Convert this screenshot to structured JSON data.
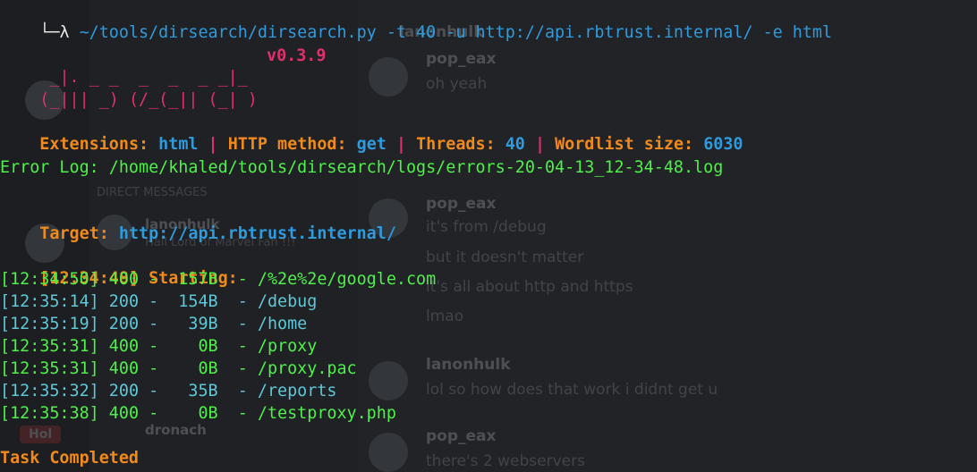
{
  "prompt": {
    "symbol": "└─λ",
    "command": " ~/tools/dirsearch/dirsearch.py -t 40 -u http://api.rbtrust.internal/ -e html"
  },
  "banner": {
    "art_line1": " _|. _ _  _  _  _ _|_",
    "art_line2": "(_||| _) (/_(_|| (_| )",
    "version": "v0.3.9"
  },
  "info": {
    "extensions_label": "Extensions: ",
    "extensions_value": "html",
    "sep": " | ",
    "method_label": "HTTP method: ",
    "method_value": "get",
    "threads_label": "Threads: ",
    "threads_value": "40",
    "wordlist_label": "Wordlist size: ",
    "wordlist_value": "6030"
  },
  "error_log": "Error Log: /home/khaled/tools/dirsearch/logs/errors-20-04-13_12-34-48.log",
  "target": {
    "label": "Target: ",
    "url": "http://api.rbtrust.internal/"
  },
  "start": {
    "time": "[12:34:48]",
    "label": " Starting: "
  },
  "results": [
    {
      "time": "[12:34:50]",
      "rest": " 400 -  157B  - /%2e%2e/google.com"
    },
    {
      "time": "[12:35:14]",
      "rest": " 200 -  154B  - /debug"
    },
    {
      "time": "[12:35:19]",
      "rest": " 200 -   39B  - /home"
    },
    {
      "time": "[12:35:31]",
      "rest": " 400 -    0B  - /proxy"
    },
    {
      "time": "[12:35:31]",
      "rest": " 400 -    0B  - /proxy.pac"
    },
    {
      "time": "[12:35:32]",
      "rest": " 200 -   35B  - /reports"
    },
    {
      "time": "[12:35:38]",
      "rest": " 400 -    0B  - /testproxy.php"
    }
  ],
  "completed": "Task Completed",
  "background_chat": {
    "header_user": "lanonhulk",
    "direct_messages": "DIRECT MESSAGES",
    "dm_user": "lanonhulk",
    "dm_status": "Hail Lord of Marvel Fan !!!",
    "server_badge": "Hol",
    "bottom_channel": "dronach",
    "messages": [
      {
        "user": "pop_eax",
        "text": "oh yeah"
      },
      {
        "user": "pop_eax",
        "text": "it's from /debug"
      },
      {
        "user": "",
        "text": "but it doesn't matter"
      },
      {
        "user": "",
        "text": "it's all about http and https"
      },
      {
        "user": "",
        "text": "lmao"
      },
      {
        "user": "lanonhulk",
        "text": "lol so how does that work i didnt get u"
      },
      {
        "user": "pop_eax",
        "text": "there's 2 webservers"
      }
    ]
  },
  "colors": {
    "background": "#1b1d21",
    "status_200": "#5ec8d8",
    "status_400": "#4ff04a",
    "accent_orange": "#f08a1c",
    "accent_blue": "#2f9bdd",
    "banner_pink": "#e0306b"
  }
}
